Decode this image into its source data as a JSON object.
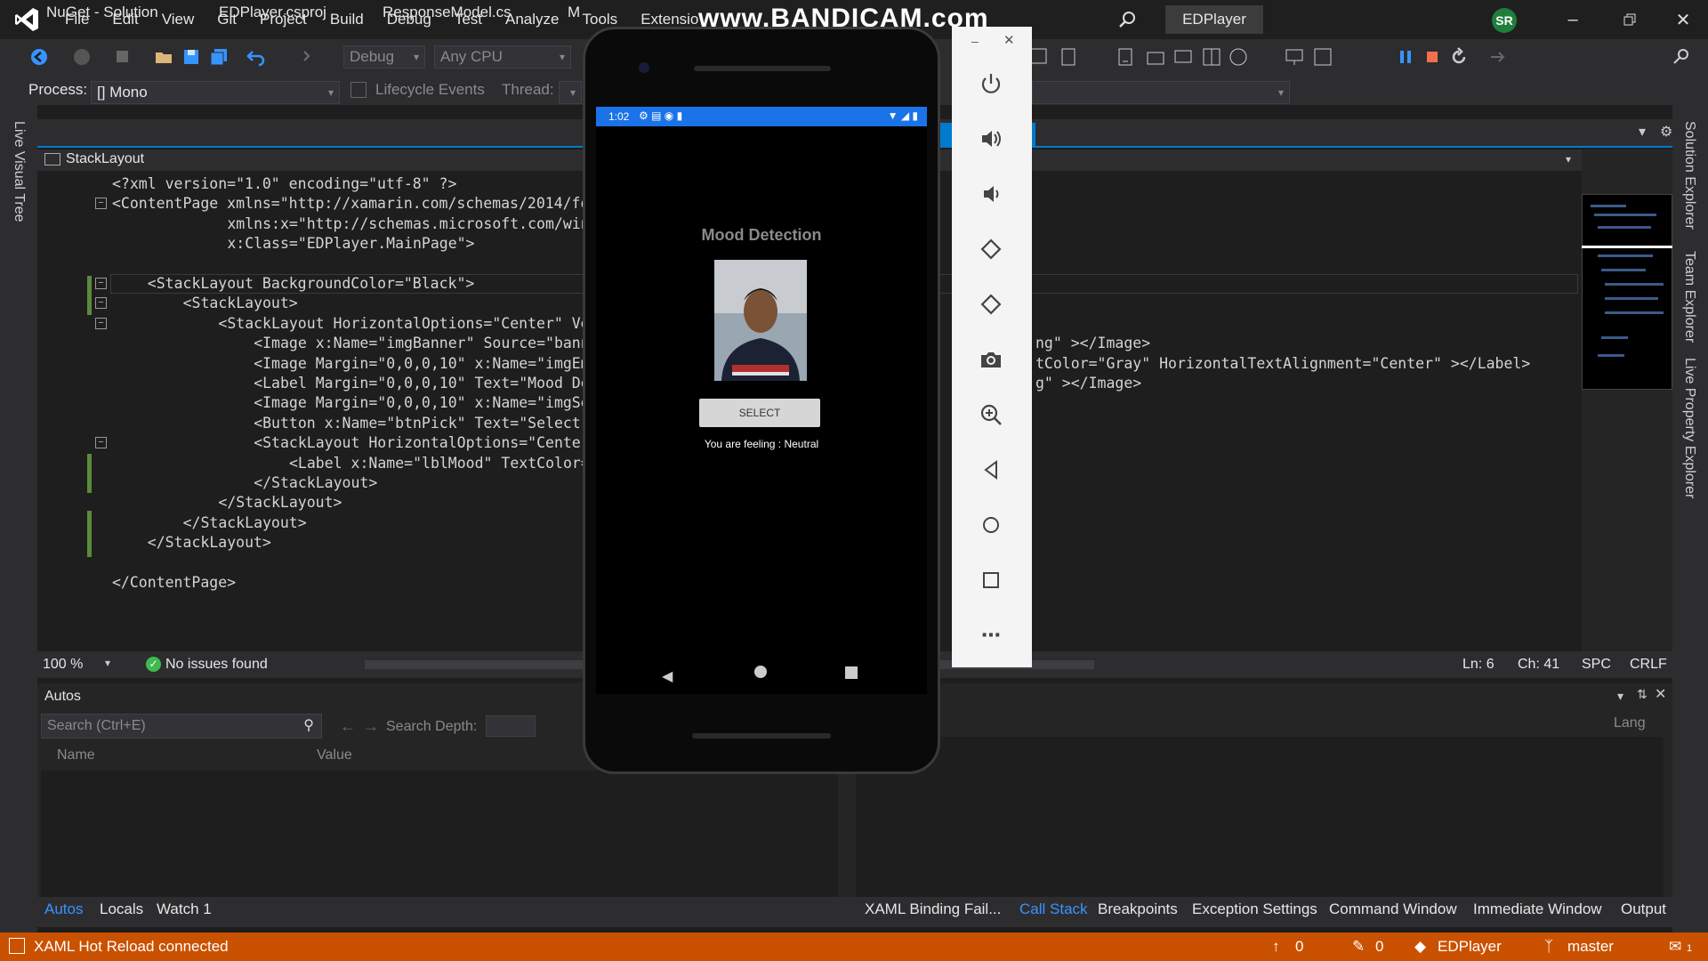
{
  "menu": {
    "items": [
      "File",
      "Edit",
      "View",
      "Git",
      "Project",
      "Build",
      "Debug",
      "Test",
      "Analyze",
      "Tools",
      "Extensio"
    ],
    "solution_name": "EDPlayer",
    "user_initials": "SR"
  },
  "watermark": "www.BANDICAM.com",
  "toolbar": {
    "configuration": "Debug",
    "platform": "Any CPU",
    "process_label": "Process:",
    "process_value": "[] Mono",
    "lifecycle_label": "Lifecycle Events",
    "thread_label": "Thread:"
  },
  "left_strip_label": "Live Visual Tree",
  "right_strip_labels": [
    "Solution Explorer",
    "Team Explorer",
    "Live Property Explorer"
  ],
  "doc_tabs": [
    "NuGet - Solution",
    "EDPlayer.csproj",
    "ResponseModel.cs",
    "M"
  ],
  "navbar_label": "StackLayout",
  "code_lines": [
    {
      "indent": 0,
      "text": "<?xml version=\"1.0\" encoding=\"utf-8\" ?>"
    },
    {
      "indent": 0,
      "text": "<ContentPage xmlns=\"http://xamarin.com/schemas/2014/fo"
    },
    {
      "indent": 13,
      "text": "xmlns:x=\"http://schemas.microsoft.com/win"
    },
    {
      "indent": 13,
      "text": "x:Class=\"EDPlayer.MainPage\">"
    },
    {
      "indent": 0,
      "text": ""
    },
    {
      "indent": 4,
      "text": "<StackLayout BackgroundColor=\"Black\">"
    },
    {
      "indent": 8,
      "text": "<StackLayout>"
    },
    {
      "indent": 12,
      "text": "<StackLayout HorizontalOptions=\"Center\" Ve"
    },
    {
      "indent": 16,
      "text": "<Image x:Name=\"imgBanner\" Source=\"bann"
    },
    {
      "indent": 16,
      "text": "<Image Margin=\"0,0,0,10\" x:Name=\"imgEm"
    },
    {
      "indent": 16,
      "text": "<Label Margin=\"0,0,0,10\" Text=\"Mood De"
    },
    {
      "indent": 16,
      "text": "<Image Margin=\"0,0,0,10\" x:Name=\"imgSe"
    },
    {
      "indent": 16,
      "text": "<Button x:Name=\"btnPick\" Text=\"Select\""
    },
    {
      "indent": 16,
      "text": "<StackLayout HorizontalOptions=\"Center"
    },
    {
      "indent": 20,
      "text": "<Label x:Name=\"lblMood\" TextColor="
    },
    {
      "indent": 16,
      "text": "</StackLayout>"
    },
    {
      "indent": 12,
      "text": "</StackLayout>"
    },
    {
      "indent": 8,
      "text": "</StackLayout>"
    },
    {
      "indent": 4,
      "text": "</StackLayout>"
    },
    {
      "indent": 0,
      "text": ""
    },
    {
      "indent": 0,
      "text": "</ContentPage>"
    }
  ],
  "code_right_lines": [
    {
      "text": "ng\" ></Image>"
    },
    {
      "text": "tColor=\"Gray\" HorizontalTextAlignment=\"Center\" ></Label>"
    },
    {
      "text": "g\" ></Image>"
    }
  ],
  "editor_status": {
    "zoom": "100 %",
    "issues": "No issues found",
    "line": "Ln: 6",
    "char": "Ch: 41",
    "spc": "SPC",
    "eol": "CRLF"
  },
  "autos_panel": {
    "title": "Autos",
    "search_placeholder": "Search (Ctrl+E)",
    "search_depth_label": "Search Depth:",
    "col_name": "Name",
    "col_value": "Value",
    "col_lang": "Lang"
  },
  "bottom_tabs_left": [
    "Autos",
    "Locals",
    "Watch 1"
  ],
  "bottom_tabs_right": [
    "XAML Binding Fail...",
    "Call Stack",
    "Breakpoints",
    "Exception Settings",
    "Command Window",
    "Immediate Window",
    "Output"
  ],
  "status_bar": {
    "message": "XAML Hot Reload connected",
    "up_count": "0",
    "pencil_count": "0",
    "project": "EDPlayer",
    "branch": "master",
    "notifications": "1"
  },
  "phone": {
    "time": "1:02",
    "app_title": "Mood Detection",
    "select_button": "SELECT",
    "mood_text": "You are feeling : Neutral"
  },
  "colors": {
    "accent": "#007acc",
    "status_bar": "#ca5100",
    "phone_statusbar": "#1a73e8"
  }
}
